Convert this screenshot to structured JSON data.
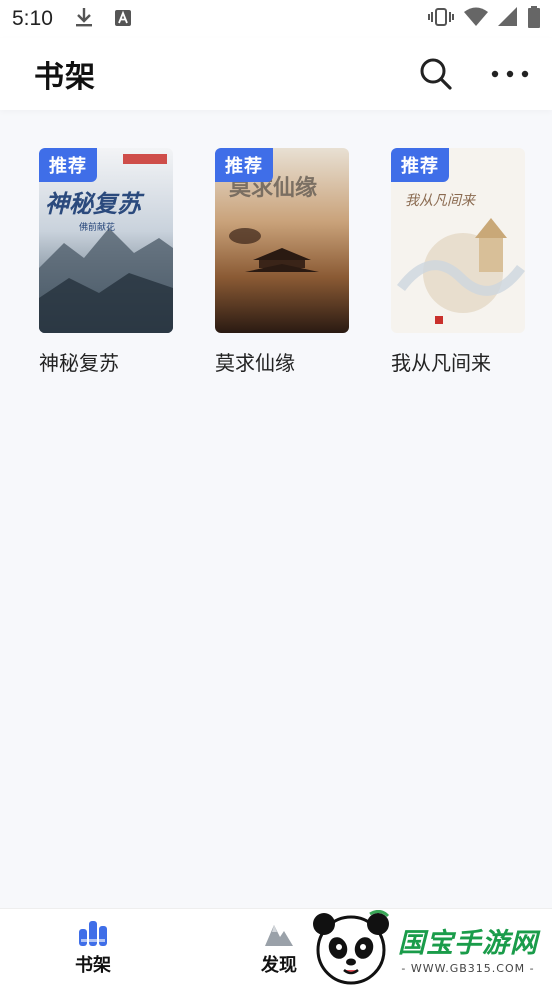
{
  "status_bar": {
    "time": "5:10"
  },
  "app_bar": {
    "title": "书架"
  },
  "books": [
    {
      "title": "神秘复苏",
      "badge": "推荐",
      "cover_text": "神秘复苏",
      "cover_author": "佛前献花"
    },
    {
      "title": "莫求仙缘",
      "badge": "推荐",
      "cover_text": "莫求仙缘",
      "cover_author": ""
    },
    {
      "title": "我从凡间来",
      "badge": "推荐",
      "cover_text": "我从凡间来",
      "cover_author": ""
    }
  ],
  "bottom_nav": {
    "items": [
      {
        "label": "书架"
      },
      {
        "label": "发现"
      }
    ]
  },
  "watermark": {
    "title": "国宝手游网",
    "url": "- WWW.GB315.COM -"
  },
  "colors": {
    "accent": "#3f6ee8",
    "background": "#f7f8fb"
  }
}
